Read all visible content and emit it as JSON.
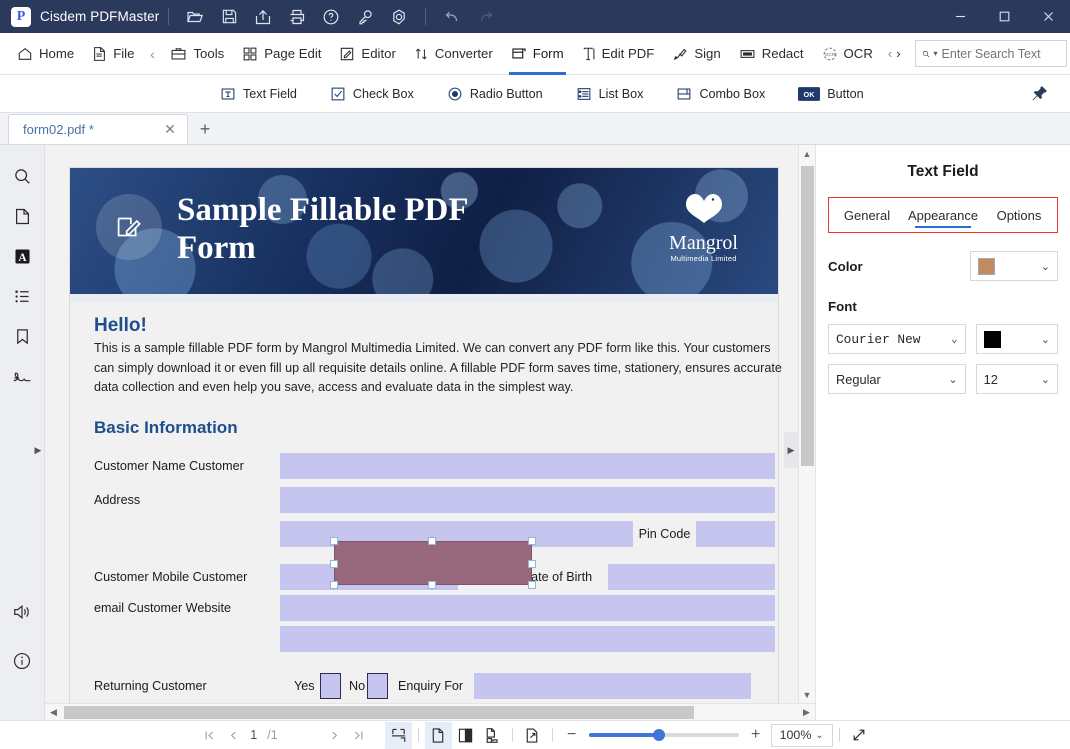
{
  "titlebar": {
    "app_name": "Cisdem PDFMaster",
    "logo_letter": "P",
    "icons": [
      "open-folder-icon",
      "save-icon",
      "share-icon",
      "print-icon",
      "help-icon",
      "key-icon",
      "settings-icon",
      "undo-icon",
      "redo-icon"
    ],
    "window_controls": [
      "minimize-button",
      "maximize-button",
      "close-button"
    ],
    "bg_color": "#2b3a5c"
  },
  "ribbon": {
    "items": [
      {
        "label": "Home",
        "icon": "home-icon",
        "active": false
      },
      {
        "label": "File",
        "icon": "file-icon",
        "active": false
      },
      {
        "label": "Tools",
        "icon": "toolbox-icon",
        "active": false
      },
      {
        "label": "Page Edit",
        "icon": "grid-icon",
        "active": false
      },
      {
        "label": "Editor",
        "icon": "pencil-square-icon",
        "active": false
      },
      {
        "label": "Converter",
        "icon": "convert-arrows-icon",
        "active": false
      },
      {
        "label": "Form",
        "icon": "form-icon",
        "active": true
      },
      {
        "label": "Edit PDF",
        "icon": "text-cursor-icon",
        "active": false
      },
      {
        "label": "Sign",
        "icon": "pen-nib-icon",
        "active": false
      },
      {
        "label": "Redact",
        "icon": "redact-icon",
        "active": false
      },
      {
        "label": "OCR",
        "icon": "ocr-icon",
        "active": false
      }
    ],
    "prev_arrow": "‹",
    "next_arrow": "›",
    "accent_color": "#2f6fd0"
  },
  "search": {
    "placeholder": "Enter Search Text",
    "value": "",
    "icon": "search-icon"
  },
  "formbar": {
    "items": [
      {
        "label": "Text Field",
        "icon": "text-field-icon"
      },
      {
        "label": "Check Box",
        "icon": "checkbox-icon"
      },
      {
        "label": "Radio Button",
        "icon": "radio-button-icon"
      },
      {
        "label": "List Box",
        "icon": "list-box-icon"
      },
      {
        "label": "Combo Box",
        "icon": "combo-box-icon"
      },
      {
        "label": "Button",
        "icon": "ok-button-icon"
      }
    ],
    "pin": "pin-icon"
  },
  "tabstrip": {
    "tab_label": "form02.pdf *",
    "close": "✕",
    "new_tab": "+"
  },
  "rail": {
    "top_icons": [
      "search-icon",
      "page-thumbnail-icon",
      "annotation-a-icon",
      "outline-list-icon",
      "bookmark-icon",
      "signature-icon"
    ],
    "bottom_icons": [
      "sound-icon",
      "info-icon"
    ],
    "selected_index": 2
  },
  "document": {
    "banner": {
      "title": "Sample Fillable PDF Form",
      "icon": "edit-document-icon",
      "brand_name": "Mangrol",
      "brand_sub": "Multimedia Limited"
    },
    "hello": "Hello!",
    "paragraph": "This is a sample fillable PDF form by Mangrol Multimedia Limited. We can convert any PDF form like this. Your customers can simply download it or even fill up all requisite details online. A fillable PDF form saves time, stationery, ensures accurate data collection and even help you save, access and evaluate data in the simplest way.",
    "section_title": "Basic Information",
    "labels": {
      "customer_name": "Customer Name Customer",
      "address": "Address",
      "pin_code": "Pin Code",
      "mobile": "Customer Mobile  Customer",
      "email_website": "email Customer Website",
      "dob": "Customer Date of Birth",
      "returning_customer": "Returning Customer",
      "yes": "Yes",
      "no": "No",
      "enquiry_for": "Enquiry For"
    },
    "selected_field_color": "#97687c",
    "field_color": "#c5c5ef"
  },
  "panel": {
    "title": "Text Field",
    "tabs": [
      {
        "label": "General",
        "active": false
      },
      {
        "label": "Appearance",
        "active": true
      },
      {
        "label": "Options",
        "active": false
      }
    ],
    "tabs_highlight_color": "#e8352e",
    "color_label": "Color",
    "color_value": "#c08b62",
    "font_label": "Font",
    "font_family": "Courier New",
    "font_color": "#000000",
    "font_style": "Regular",
    "font_size": "12"
  },
  "statusbar": {
    "first_page": "first-page-icon",
    "prev_page": "prev-page-icon",
    "current_page": "1",
    "total_pages": "/1",
    "next_page": "next-page-icon",
    "last_page": "last-page-icon",
    "view_icons": [
      "fit-page-icon",
      "single-page-icon",
      "two-page-icon",
      "multi-page-icon",
      "rotate-icon"
    ],
    "zoom_out": "−",
    "zoom_in": "+",
    "zoom_value": "100%",
    "zoom_chevron": "⌄",
    "fullscreen": "fullscreen-icon",
    "slider_percent": 45
  }
}
